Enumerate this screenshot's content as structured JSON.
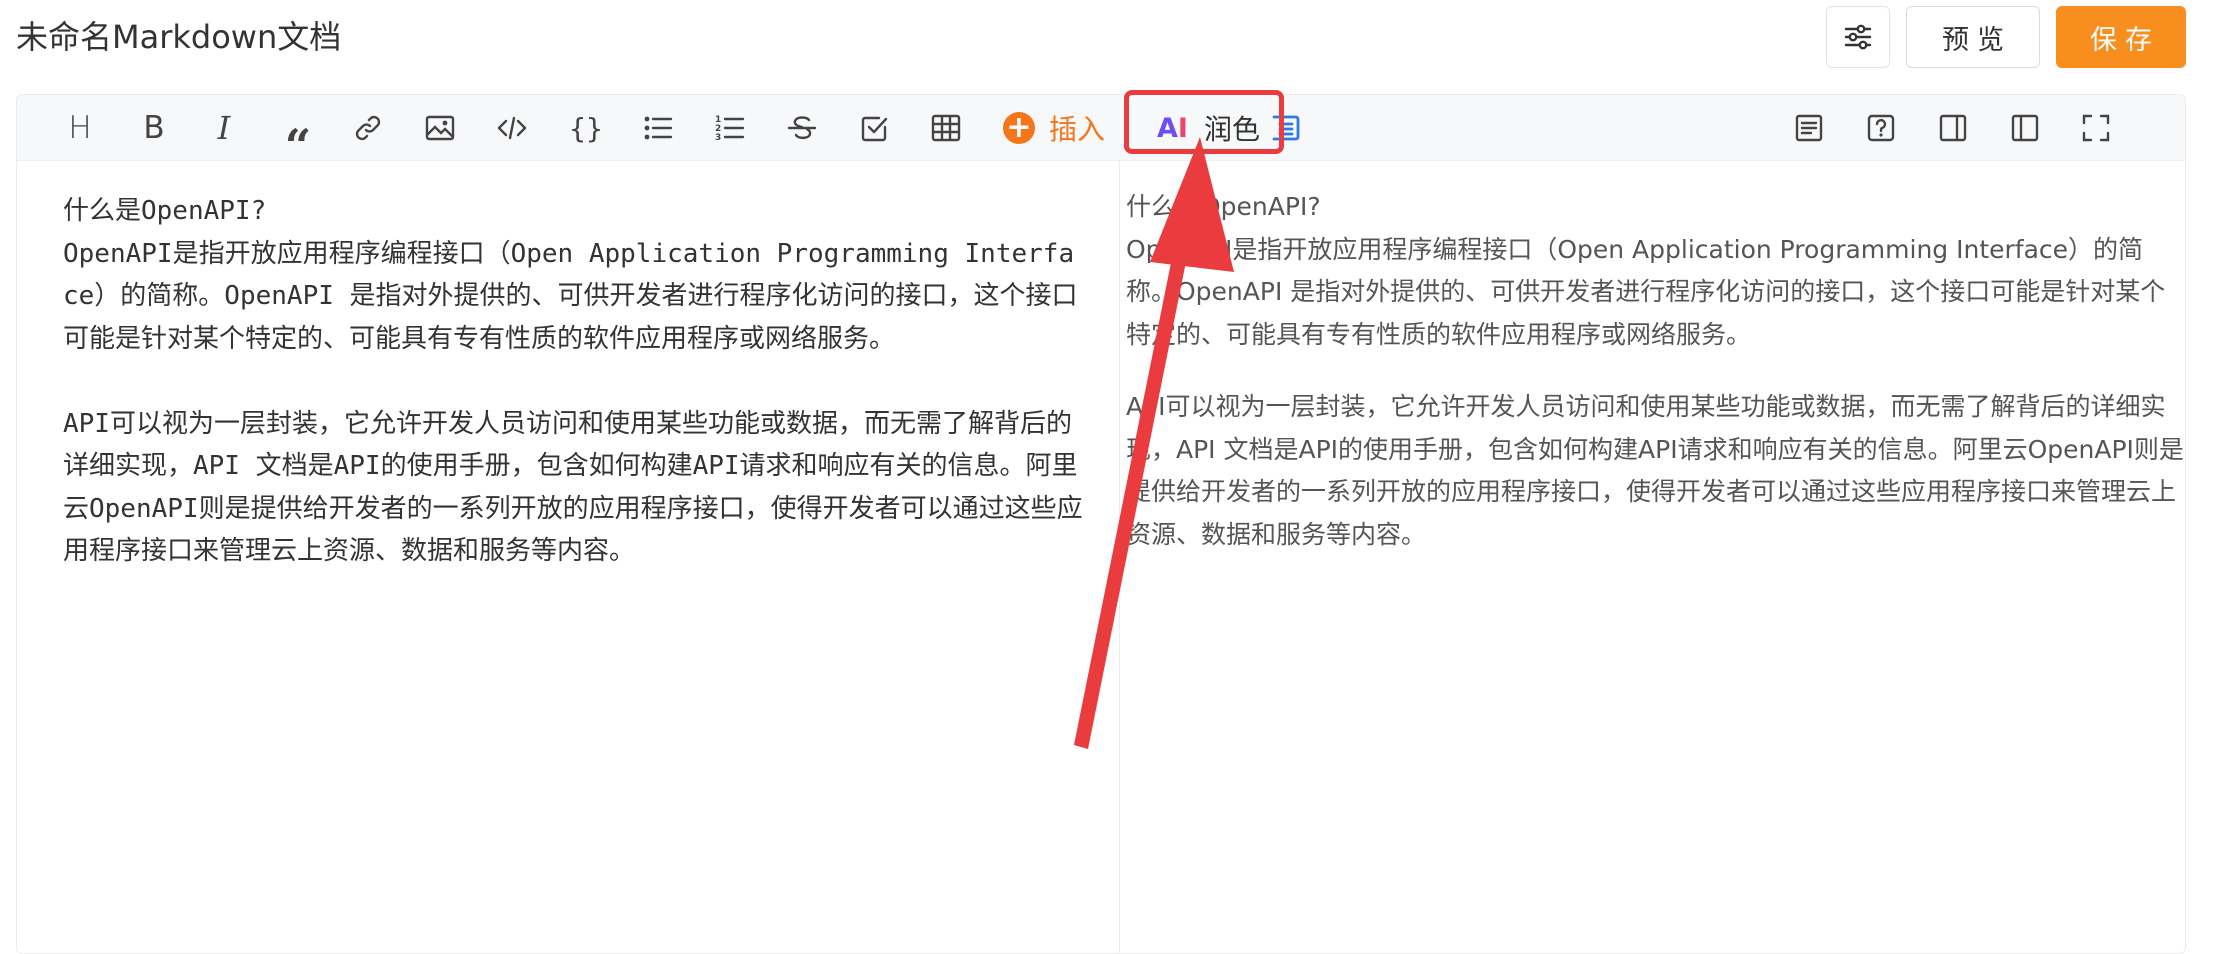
{
  "document": {
    "title": "未命名Markdown文档"
  },
  "header": {
    "preview_label": "预览",
    "save_label": "保存",
    "settings_icon": "sliders-icon"
  },
  "toolbar": {
    "insert_label": "插入",
    "polish_label": "润色",
    "ai_logo_text": "AI",
    "left_tools": [
      "heading",
      "bold",
      "italic",
      "quote",
      "link",
      "image",
      "code",
      "code-block",
      "unordered-list",
      "ordered-list",
      "strikethrough",
      "checklist",
      "table"
    ],
    "right_tools": [
      "outline-toggle",
      "help",
      "preview-only",
      "editor-only",
      "fullscreen"
    ],
    "accent_color": "#f5761a",
    "highlight_color": "#ea3b3f"
  },
  "editor": {
    "source_text": "什么是OpenAPI?\nOpenAPI是指开放应用程序编程接口（Open Application Programming Interface）的简称。OpenAPI 是指对外提供的、可供开发者进行程序化访问的接口，这个接口可能是针对某个特定的、可能具有专有性质的软件应用程序或网络服务。\n\nAPI可以视为一层封装，它允许开发人员访问和使用某些功能或数据，而无需了解背后的详细实现，API 文档是API的使用手册，包含如何构建API请求和响应有关的信息。阿里云OpenAPI则是提供给开发者的一系列开放的应用程序接口，使得开发者可以通过这些应用程序接口来管理云上资源、数据和服务等内容。"
  },
  "preview": {
    "paragraph_1_line_1": "什么是OpenAPI?",
    "paragraph_1_rest": "OpenAPI是指开放应用程序编程接口（Open Application Programming Interface）的简称。OpenAPI 是指对外提供的、可供开发者进行程序化访问的接口，这个接口可能是针对某个特定的、可能具有专有性质的软件应用程序或网络服务。",
    "paragraph_2": "API可以视为一层封装，它允许开发人员访问和使用某些功能或数据，而无需了解背后的详细实现，API 文档是API的使用手册，包含如何构建API请求和响应有关的信息。阿里云OpenAPI则是提供给开发者的一系列开放的应用程序接口，使得开发者可以通过这些应用程序接口来管理云上资源、数据和服务等内容。"
  }
}
